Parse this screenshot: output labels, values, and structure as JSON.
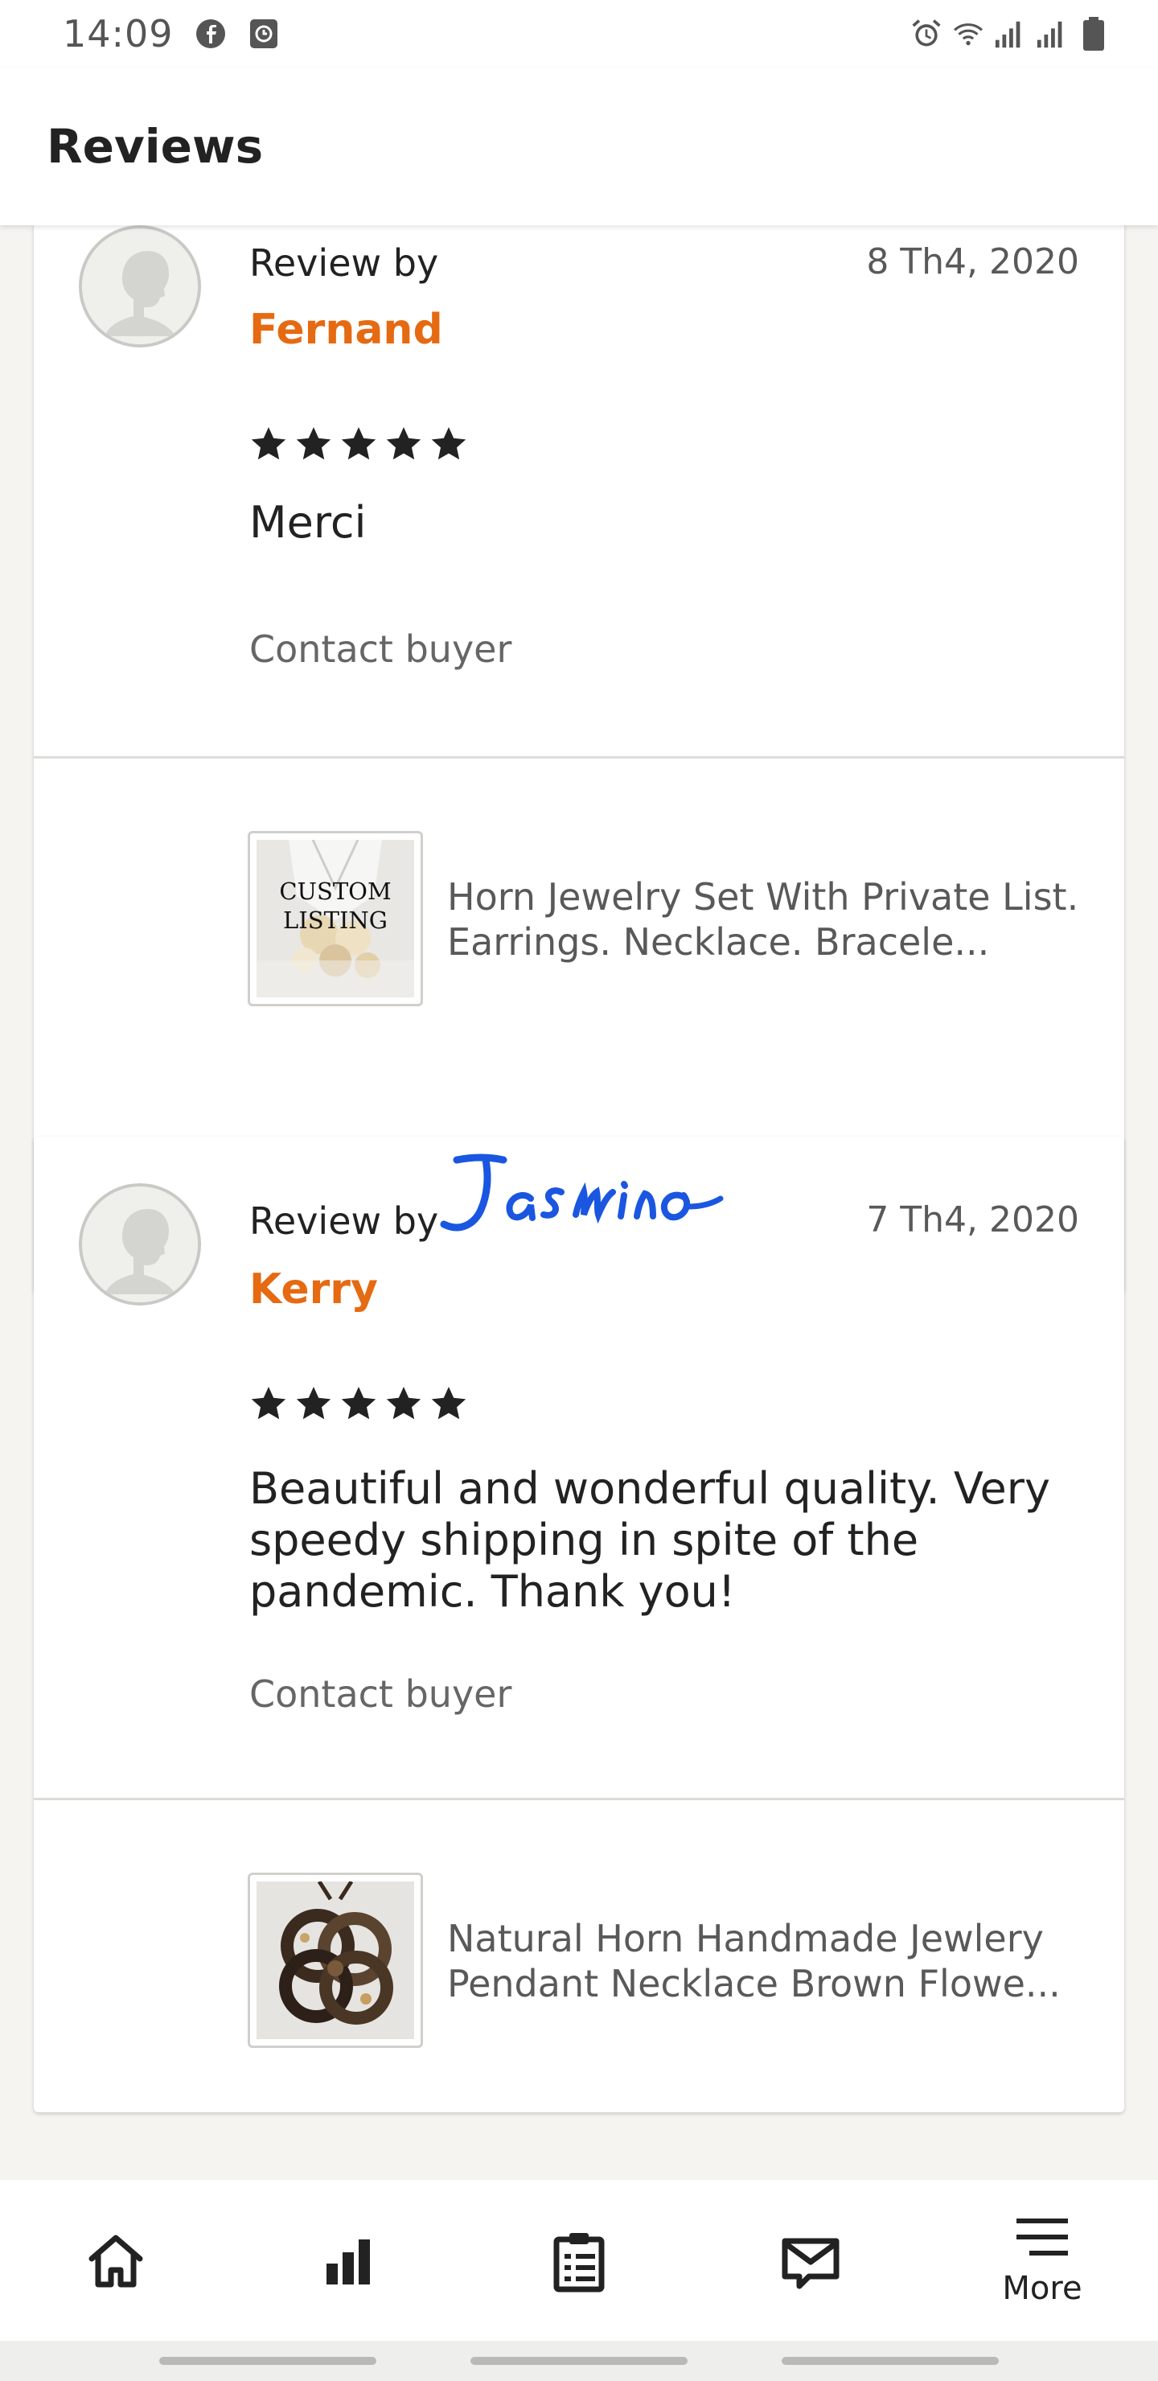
{
  "status_bar": {
    "time": "14:09",
    "left_icons": [
      "facebook-icon",
      "screen-record-icon"
    ],
    "right_icons": [
      "alarm-icon",
      "wifi-icon",
      "signal-icon",
      "signal-icon",
      "battery-icon"
    ]
  },
  "app_bar": {
    "title": "Reviews"
  },
  "reviews": [
    {
      "label": "Review by",
      "reviewer": "Fernand",
      "date": "8 Th4, 2020",
      "rating": 5,
      "text": "Merci",
      "contact_label": "Contact buyer",
      "listing": {
        "thumb_caption": "CUSTOM LISTING",
        "title": "Horn Jewelry Set With Private List. Earrings. Necklace. Bracele..."
      }
    },
    {
      "label": "Review by",
      "reviewer": "Kerry",
      "date": "7 Th4, 2020",
      "rating": 5,
      "text": "Beautiful and wonderful quality. Very speedy shipping in spite of the pandemic.  Thank you!",
      "contact_label": "Contact buyer",
      "listing": {
        "title": "Natural Horn Handmade Jewlery Pendant Necklace Brown Flowe..."
      }
    }
  ],
  "signature": {
    "text": "Jasmino",
    "color": "#1a56e0"
  },
  "bottom_nav": {
    "items": [
      {
        "icon": "home-icon"
      },
      {
        "icon": "stats-icon"
      },
      {
        "icon": "orders-icon"
      },
      {
        "icon": "messages-icon"
      },
      {
        "icon": "menu-icon",
        "label": "More"
      }
    ]
  },
  "colors": {
    "accent": "#e56a12",
    "background": "#f5f4f1",
    "card": "#ffffff",
    "text": "#222222",
    "muted": "#595959"
  }
}
